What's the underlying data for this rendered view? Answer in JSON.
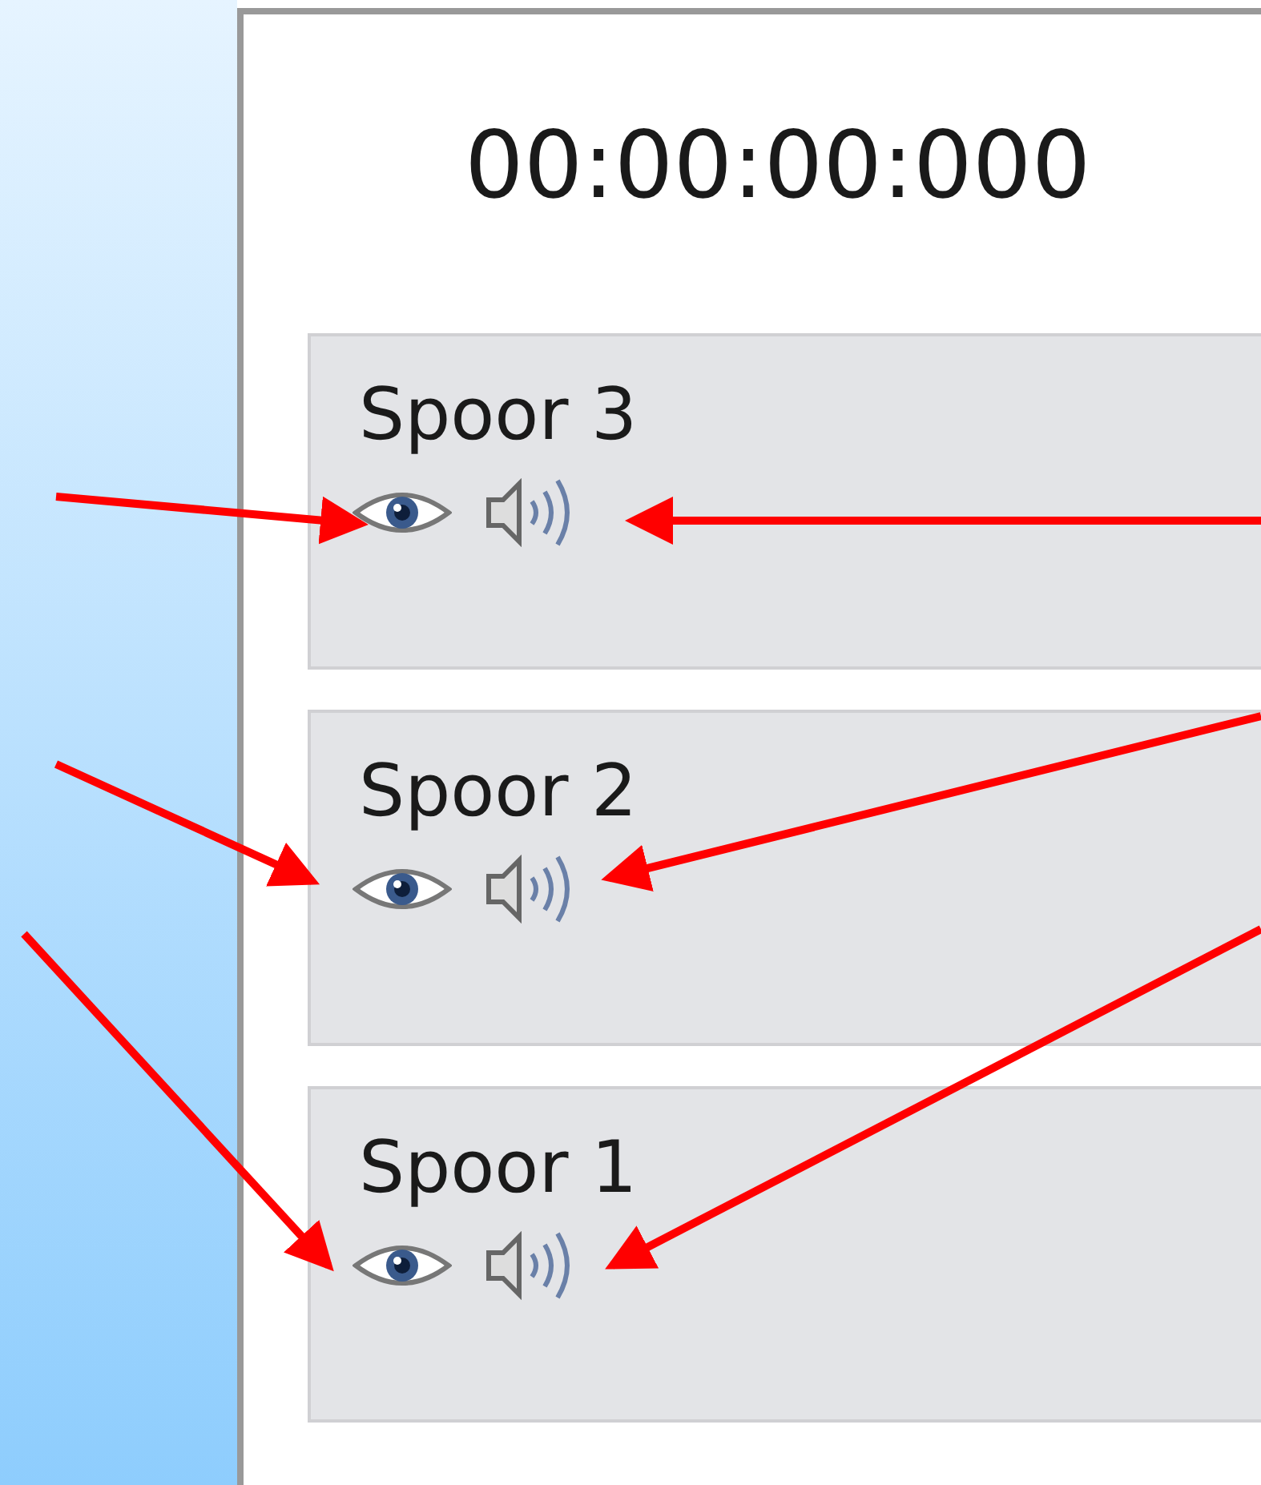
{
  "timecode": "00:00:00:000",
  "tracks": [
    {
      "name": "Spoor 3"
    },
    {
      "name": "Spoor 2"
    },
    {
      "name": "Spoor 1"
    }
  ]
}
